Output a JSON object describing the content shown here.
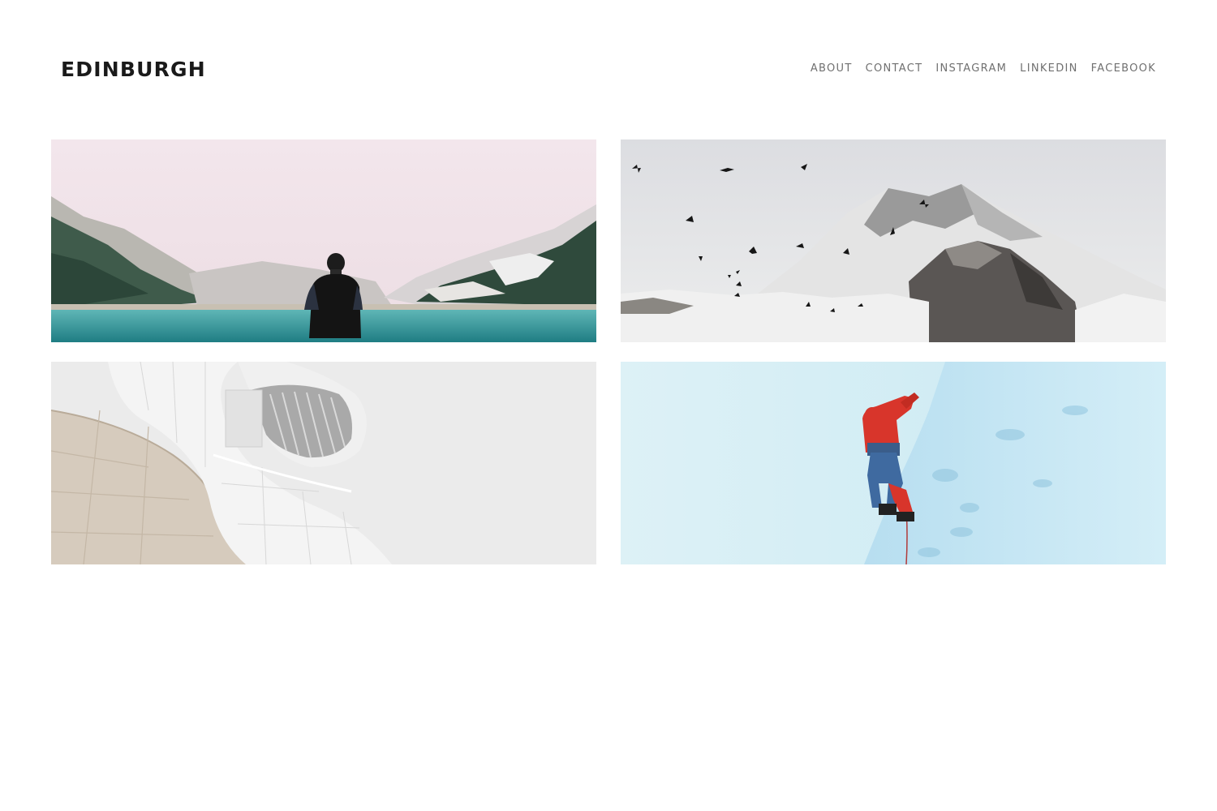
{
  "site": {
    "title": "EDINBURGH"
  },
  "nav": {
    "items": [
      {
        "label": "ABOUT"
      },
      {
        "label": "CONTACT"
      },
      {
        "label": "INSTAGRAM"
      },
      {
        "label": "LINKEDIN"
      },
      {
        "label": "FACEBOOK"
      }
    ]
  },
  "colors": {
    "brand_text": "#1a1a1a",
    "nav_text": "#707070",
    "background": "#ffffff"
  }
}
